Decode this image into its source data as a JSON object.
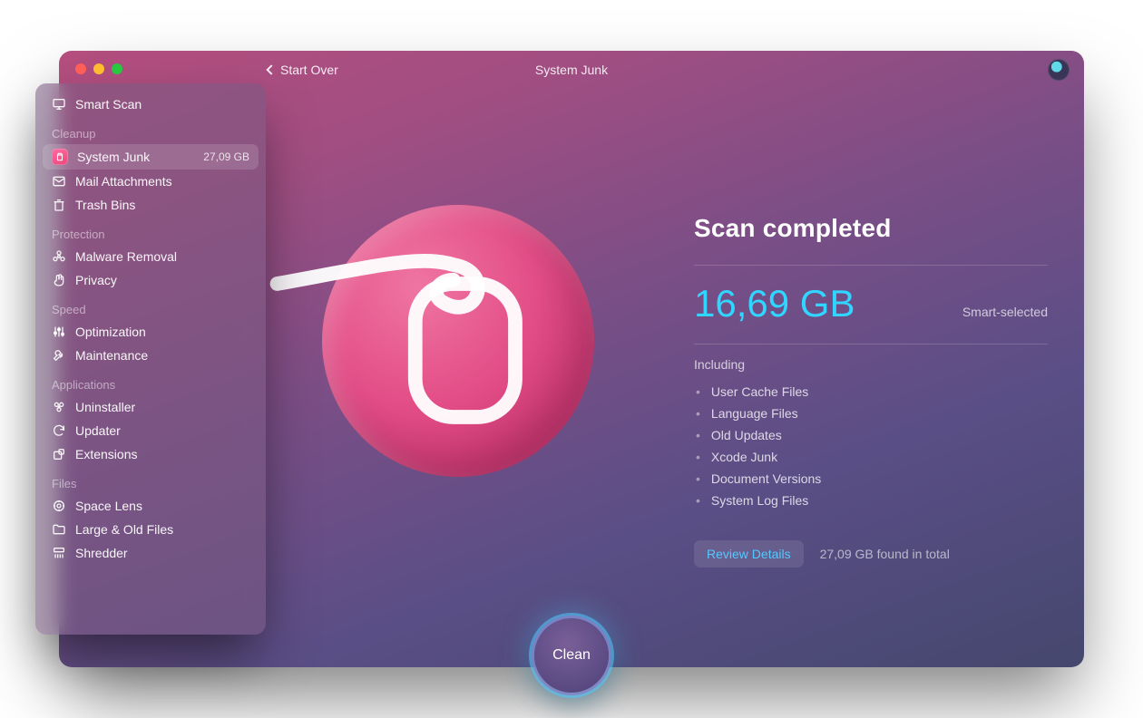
{
  "topbar": {
    "start_over": "Start Over",
    "title": "System Junk"
  },
  "sidebar": {
    "smart_scan": "Smart Scan",
    "sections": {
      "cleanup": {
        "header": "Cleanup",
        "items": [
          {
            "label": "System Junk",
            "badge": "27,09 GB",
            "active": true
          },
          {
            "label": "Mail Attachments"
          },
          {
            "label": "Trash Bins"
          }
        ]
      },
      "protection": {
        "header": "Protection",
        "items": [
          {
            "label": "Malware Removal"
          },
          {
            "label": "Privacy"
          }
        ]
      },
      "speed": {
        "header": "Speed",
        "items": [
          {
            "label": "Optimization"
          },
          {
            "label": "Maintenance"
          }
        ]
      },
      "applications": {
        "header": "Applications",
        "items": [
          {
            "label": "Uninstaller"
          },
          {
            "label": "Updater"
          },
          {
            "label": "Extensions"
          }
        ]
      },
      "files": {
        "header": "Files",
        "items": [
          {
            "label": "Space Lens"
          },
          {
            "label": "Large & Old Files"
          },
          {
            "label": "Shredder"
          }
        ]
      }
    }
  },
  "results": {
    "heading": "Scan completed",
    "size": "16,69 GB",
    "size_sub": "Smart-selected",
    "including_label": "Including",
    "items": [
      "User Cache Files",
      "Language Files",
      "Old Updates",
      "Xcode Junk",
      "Document Versions",
      "System Log Files"
    ],
    "review_label": "Review Details",
    "found_total": "27,09 GB found in total"
  },
  "clean_label": "Clean"
}
